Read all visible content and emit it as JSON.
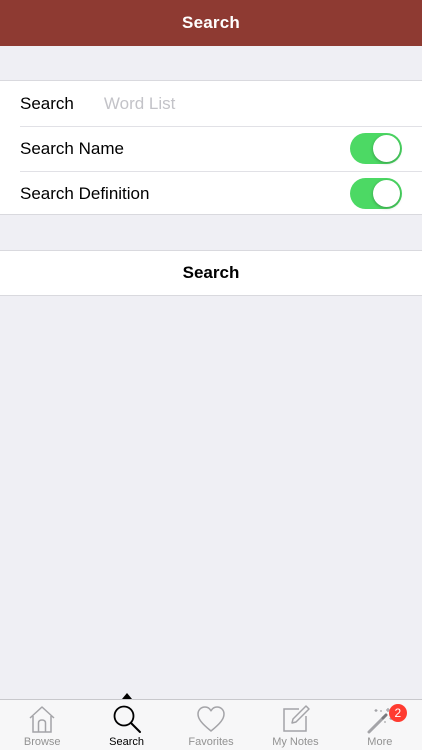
{
  "navbar": {
    "title": "Search"
  },
  "form": {
    "search_label": "Search",
    "search_placeholder": "Word List",
    "search_value": "",
    "search_name_label": "Search Name",
    "search_name_on": true,
    "search_definition_label": "Search Definition",
    "search_definition_on": true
  },
  "action": {
    "search_button": "Search"
  },
  "tabbar": {
    "items": [
      {
        "label": "Browse",
        "icon": "house-icon",
        "active": false
      },
      {
        "label": "Search",
        "icon": "magnifier-icon",
        "active": true
      },
      {
        "label": "Favorites",
        "icon": "heart-icon",
        "active": false
      },
      {
        "label": "My Notes",
        "icon": "note-pencil-icon",
        "active": false
      },
      {
        "label": "More",
        "icon": "magic-wand-icon",
        "active": false,
        "badge": "2"
      }
    ]
  },
  "colors": {
    "navbar": "#8e3a32",
    "toggle_on": "#4cd964",
    "badge": "#ff3b30",
    "background": "#efeff4"
  }
}
